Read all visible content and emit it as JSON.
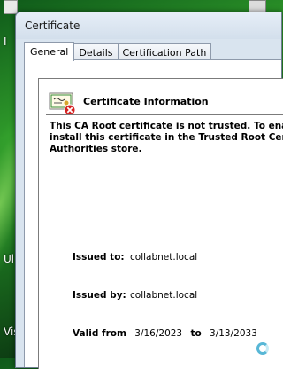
{
  "window": {
    "title": "Certificate"
  },
  "tabs": [
    {
      "label": "General",
      "active": true
    },
    {
      "label": "Details",
      "active": false
    },
    {
      "label": "Certification Path",
      "active": false
    }
  ],
  "info": {
    "heading": "Certificate Information",
    "message_lines": [
      "This CA Root certificate is not trusted. To ena",
      "install this certificate in the Trusted Root Cer",
      "Authorities store."
    ]
  },
  "fields": {
    "issued_to_label": "Issued to:",
    "issued_to_value": "collabnet.local",
    "issued_by_label": "Issued by:",
    "issued_by_value": "collabnet.local",
    "valid_from_label": "Valid from",
    "valid_from_value": "3/16/2023",
    "valid_to_label": "to",
    "valid_to_value": "3/13/2033"
  },
  "desktop": {
    "labels": [
      "I",
      "Ul",
      "Vis"
    ]
  },
  "icons": {
    "certificate": "certificate-untrusted-icon",
    "busy": "busy-spinner-icon"
  },
  "colors": {
    "desktop_green": "#2f9a2a",
    "error_red": "#d42020",
    "spinner": "#58b7d6"
  }
}
